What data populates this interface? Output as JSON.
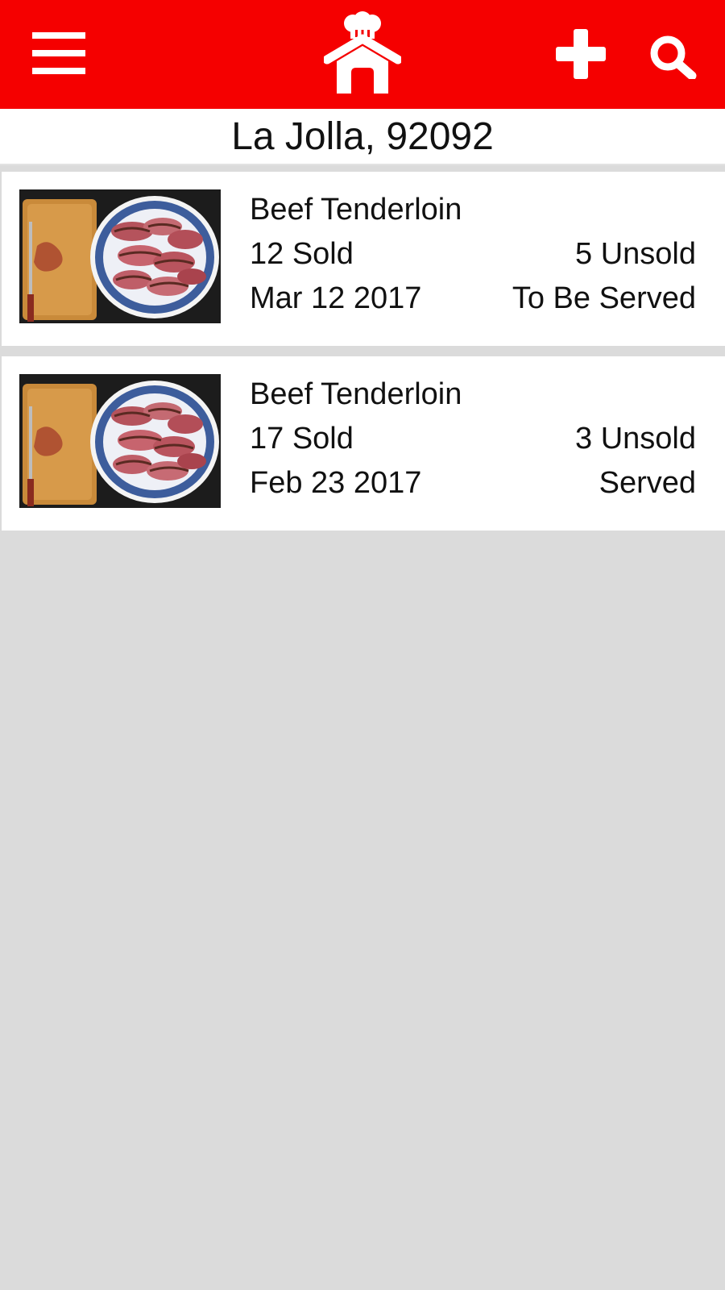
{
  "header": {
    "menu_icon": "menu-icon",
    "home_icon": "chef-house-icon",
    "add_icon": "plus-icon",
    "search_icon": "search-icon",
    "brand_color": "#f50000"
  },
  "location": {
    "label": "La Jolla, 92092"
  },
  "listings": [
    {
      "title": "Beef Tenderloin",
      "sold": "12 Sold",
      "unsold": "5 Unsold",
      "date": "Mar 12 2017",
      "status": "To Be Served"
    },
    {
      "title": "Beef Tenderloin",
      "sold": "17 Sold",
      "unsold": "3 Unsold",
      "date": "Feb 23 2017",
      "status": "Served"
    }
  ]
}
